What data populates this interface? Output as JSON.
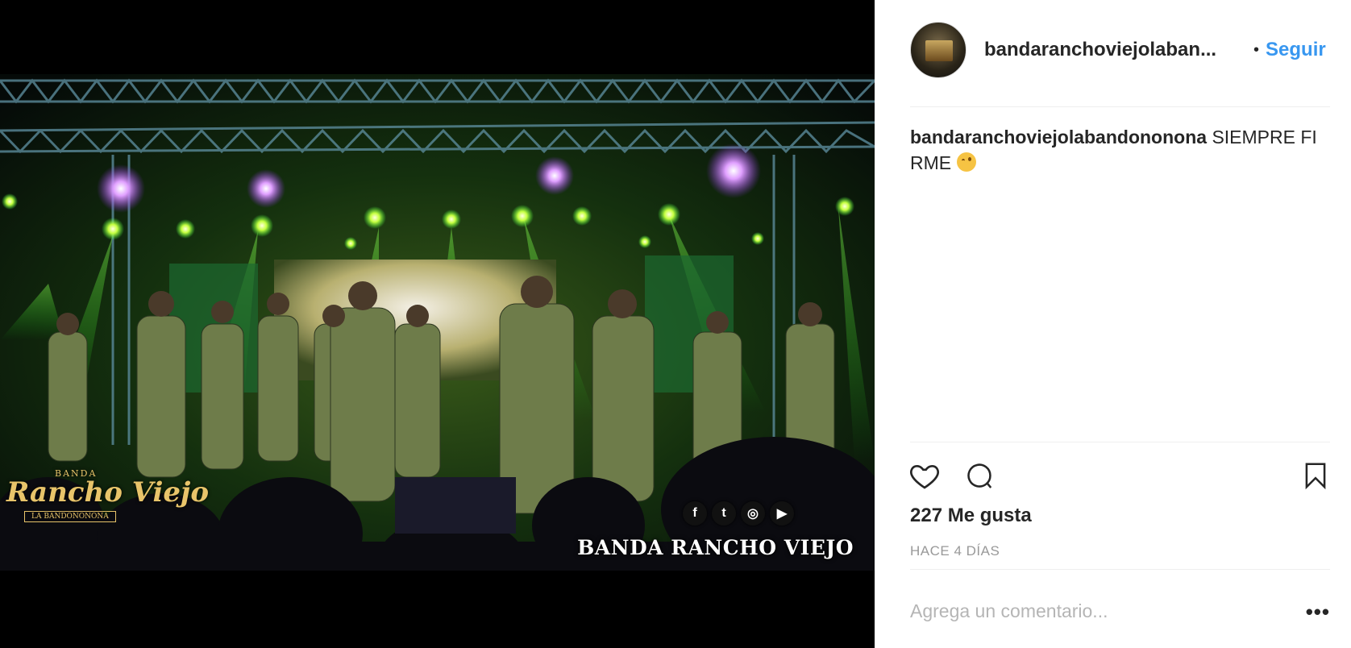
{
  "post": {
    "username": "bandaranchoviejolaban...",
    "follow_label": "Seguir",
    "dot": "•",
    "caption_user": "bandaranchoviejolabandononona",
    "caption_text": "SIEMPRE FIRME",
    "likes": "227 Me gusta",
    "time": "HACE 4 DÍAS",
    "comment_placeholder": "Agrega un comentario...",
    "more": "•••"
  },
  "media_overlay": {
    "logo_top": "BANDA",
    "logo_main": "Rancho Viejo",
    "logo_bottom": "LA BANDONONONA",
    "band_name": "BANDA RANCHO VIEJO",
    "social": [
      "f",
      "t",
      "◎",
      "▶"
    ]
  },
  "icons": {
    "like": "heart-icon",
    "comment": "comment-icon",
    "save": "bookmark-icon",
    "emoji": "wink-emoji-icon"
  },
  "colors": {
    "link": "#3897f0",
    "text": "#262626",
    "muted": "#999999",
    "separator": "#efefef"
  }
}
